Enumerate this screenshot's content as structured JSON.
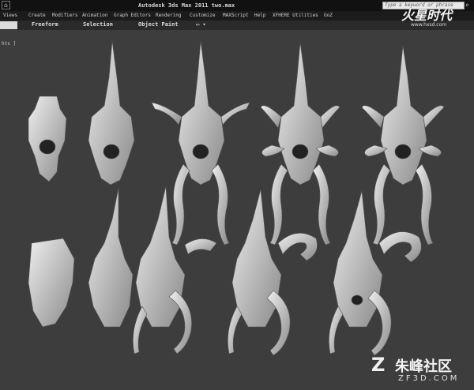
{
  "window": {
    "title": "Autodesk 3ds Max  2011    two.max",
    "search_placeholder": "Type a keyword or phrase"
  },
  "menu": [
    "Views",
    "Create",
    "Modifiers",
    "Animation",
    "Graph Editors",
    "Rendering",
    "Customize",
    "MAXScript",
    "Help",
    "XFHERE Utilities",
    "GoZ"
  ],
  "ribbon_tabs": [
    "Freeform",
    "Selection",
    "Object Paint"
  ],
  "viewport": {
    "label": "hts ]"
  },
  "watermarks": {
    "top_logo": "火星时代",
    "top_url": "www.hxsd.com",
    "bottom_logo": "朱峰社区",
    "bottom_url": "ZF3D.COM"
  }
}
